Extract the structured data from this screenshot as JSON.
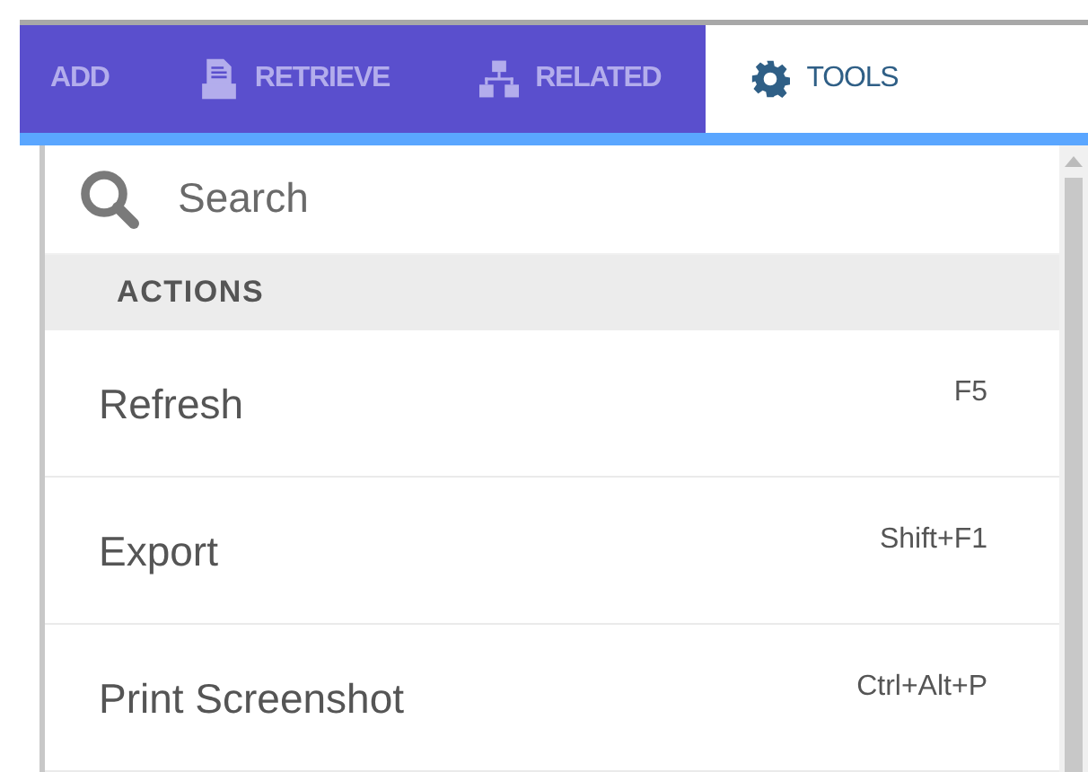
{
  "tabs": [
    {
      "label": "ADD",
      "selected": false
    },
    {
      "label": "RETRIEVE",
      "selected": false
    },
    {
      "label": "RELATED",
      "selected": false
    },
    {
      "label": "TOOLS",
      "selected": true
    }
  ],
  "search": {
    "placeholder": "Search"
  },
  "section": {
    "title": "ACTIONS"
  },
  "actions": [
    {
      "label": "Refresh",
      "shortcut": "F5"
    },
    {
      "label": "Export",
      "shortcut": "Shift+F1"
    },
    {
      "label": "Print Screenshot",
      "shortcut": "Ctrl+Alt+P"
    }
  ]
}
